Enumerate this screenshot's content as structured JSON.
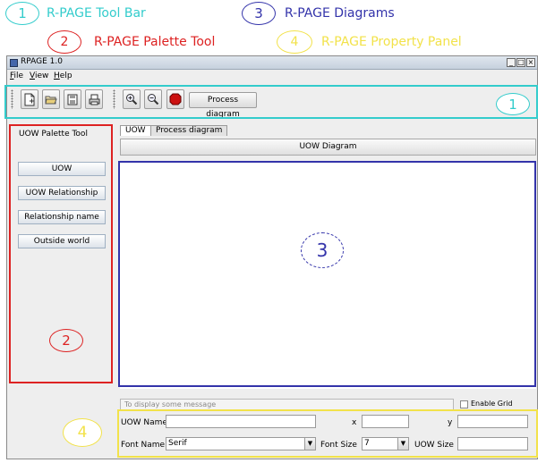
{
  "legend": [
    {
      "number": "1",
      "label": "R-PAGE Tool Bar",
      "color": "#33cccc"
    },
    {
      "number": "2",
      "label": "R-PAGE Palette Tool",
      "color": "#dd2222"
    },
    {
      "number": "3",
      "label": "R-PAGE Diagrams",
      "color": "#3333aa"
    },
    {
      "number": "4",
      "label": "R-PAGE Property Panel",
      "color": "#f2e24a"
    }
  ],
  "window": {
    "title": "RPAGE 1.0",
    "minimize": "_",
    "maximize": "□",
    "close": "×"
  },
  "menu": [
    "File",
    "View",
    "Help"
  ],
  "toolbar": {
    "icons": [
      "new-document-icon",
      "open-folder-icon",
      "save-icon",
      "print-icon",
      "zoom-in-icon",
      "zoom-out-icon",
      "stop-icon"
    ],
    "process_label": "Process diagram"
  },
  "palette": {
    "title": "UOW Palette Tool",
    "items": [
      "UOW",
      "UOW Relationship",
      "Relationship name",
      "Outside world"
    ]
  },
  "tabs": [
    {
      "label": "UOW",
      "active": true
    },
    {
      "label": "Process diagram",
      "active": false
    }
  ],
  "diagram": {
    "header": "UOW Diagram"
  },
  "status": {
    "message": "To display some message",
    "enable_grid_label": "Enable Grid"
  },
  "properties": {
    "uow_name_label": "UOW Name",
    "uow_name_value": "",
    "x_label": "x",
    "x_value": "",
    "y_label": "y",
    "y_value": "",
    "font_name_label": "Font Name",
    "font_name_value": "Serif",
    "font_size_label": "Font Size",
    "font_size_value": "7",
    "uow_size_label": "UOW Size",
    "uow_size_value": ""
  },
  "highlights": [
    {
      "number": "1",
      "color": "#33cccc"
    },
    {
      "number": "2",
      "color": "#dd2222"
    },
    {
      "number": "3",
      "color": "#3333aa"
    },
    {
      "number": "4",
      "color": "#f2e24a"
    }
  ]
}
